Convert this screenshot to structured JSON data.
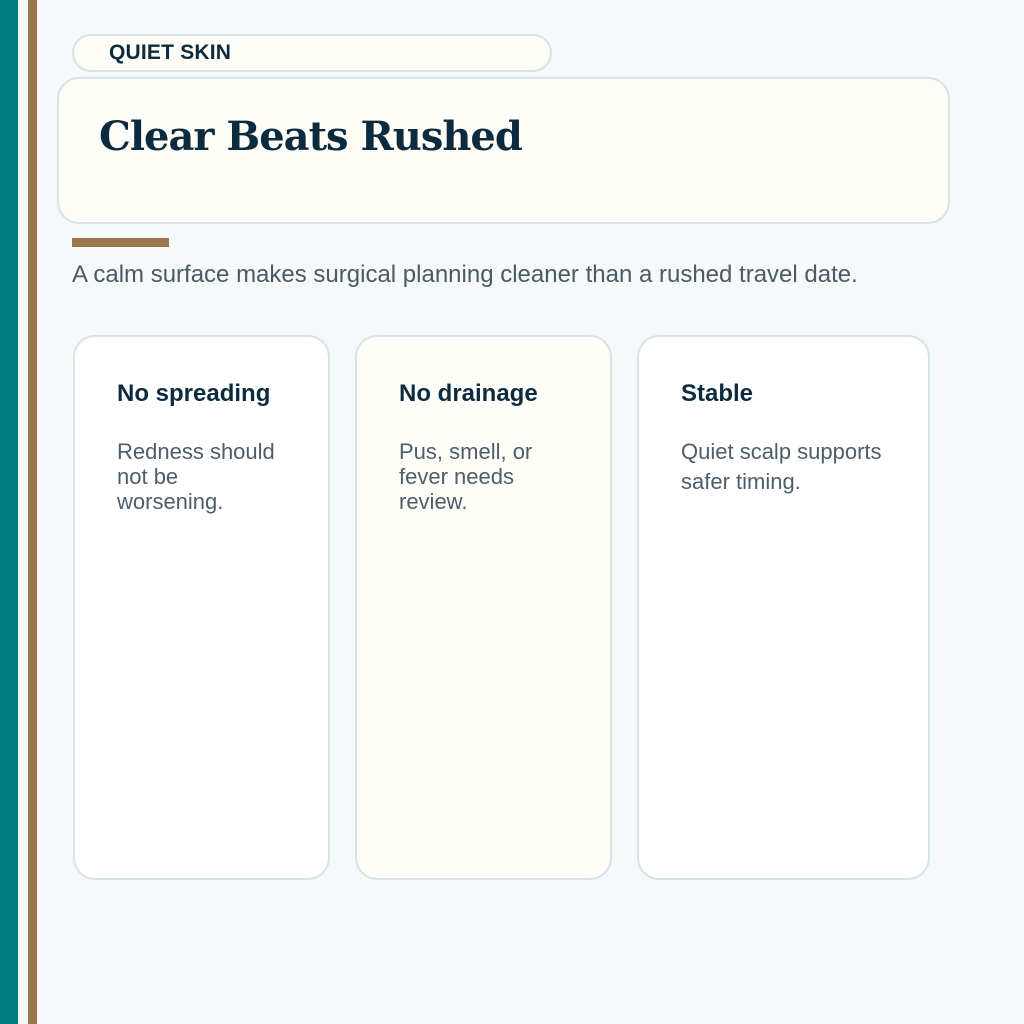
{
  "eyebrow": "QUIET SKIN",
  "title": "Clear Beats Rushed",
  "summary": "A calm surface makes surgical planning cleaner than a rushed travel date.",
  "cards": [
    {
      "title": "No spreading",
      "body": "Redness should not be worsening."
    },
    {
      "title": "No drainage",
      "body": "Pus, smell, or fever needs review."
    },
    {
      "title": "Stable",
      "body": "Quiet scalp supports safer timing."
    }
  ],
  "colors": {
    "background": "#f5f9f9",
    "teal_rail": "#007c7e",
    "brown_accent": "#99764b",
    "heading": "#0d2b3e",
    "body_text": "#4a5a66",
    "card_border": "#d8e3e6",
    "cream_panel": "#fefdf8"
  }
}
